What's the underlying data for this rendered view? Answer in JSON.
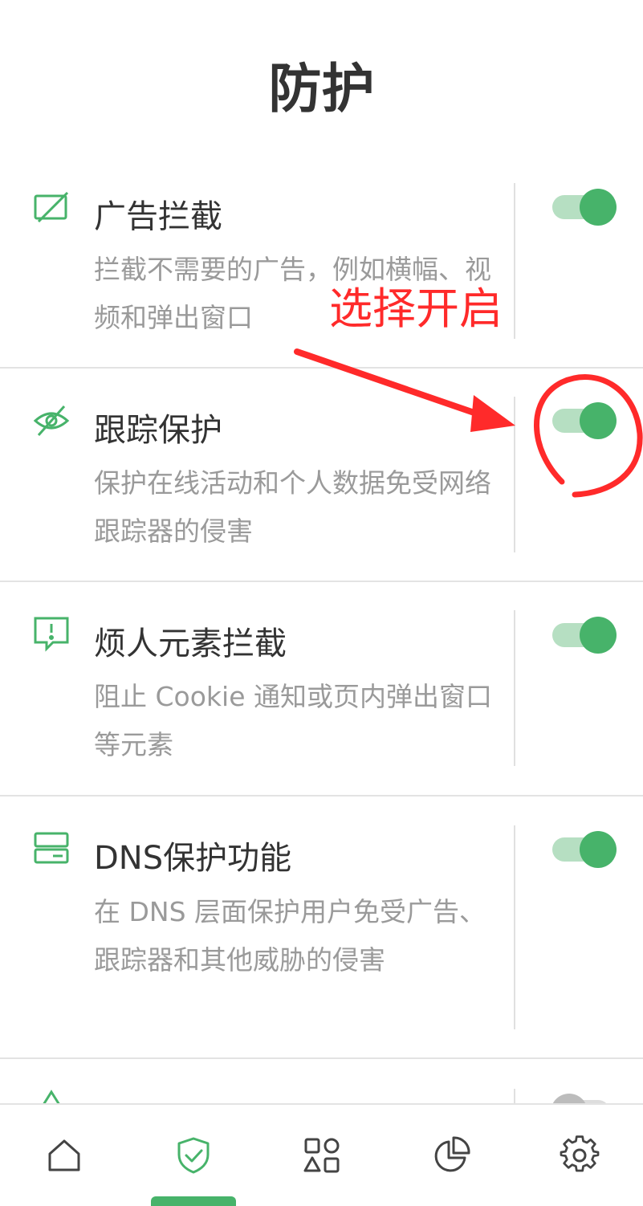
{
  "header": {
    "title": "防护"
  },
  "items": [
    {
      "title": "广告拦截",
      "description": "拦截不需要的广告，例如横幅、视频和弹出窗口",
      "enabled": true,
      "icon": "ad-block-icon"
    },
    {
      "title": "跟踪保护",
      "description": "保护在线活动和个人数据免受网络跟踪器的侵害",
      "enabled": true,
      "icon": "eye-off-icon"
    },
    {
      "title": "烦人元素拦截",
      "description": "阻止 Cookie 通知或页内弹出窗口等元素",
      "enabled": true,
      "icon": "message-alert-icon"
    },
    {
      "title": "DNS保护功能",
      "description": "在 DNS 层面保护用户免受广告、跟踪器和其他威胁的侵害",
      "enabled": true,
      "icon": "server-icon"
    },
    {
      "title": "",
      "description": "",
      "enabled": false,
      "icon": "partial-item-icon"
    }
  ],
  "annotation": {
    "text": "选择开启",
    "color": "#ff2a2a"
  },
  "bottom_nav": {
    "items": [
      {
        "id": "home",
        "icon": "home-icon",
        "active": false
      },
      {
        "id": "protection",
        "icon": "shield-check-icon",
        "active": true
      },
      {
        "id": "apps",
        "icon": "apps-icon",
        "active": false
      },
      {
        "id": "statistics",
        "icon": "pie-chart-icon",
        "active": false
      },
      {
        "id": "settings",
        "icon": "gear-icon",
        "active": false
      }
    ]
  },
  "colors": {
    "accent": "#47b36a",
    "toggle_track": "#b6dfc2",
    "annotation": "#ff2a2a"
  }
}
